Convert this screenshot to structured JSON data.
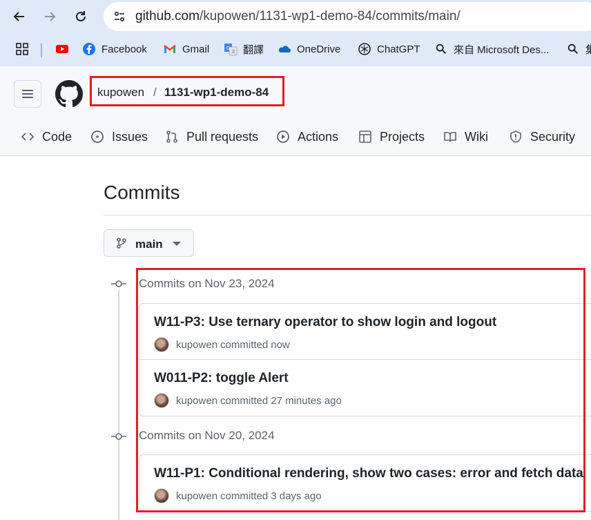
{
  "browser": {
    "url_host": "github.com",
    "url_path": "/kupowen/1131-wp1-demo-84/commits/main/",
    "bookmarks": [
      {
        "label": "",
        "icon": "apps-grid-icon"
      },
      {
        "label": "",
        "icon": "youtube-icon"
      },
      {
        "label": "Facebook",
        "icon": "facebook-icon"
      },
      {
        "label": "Gmail",
        "icon": "gmail-icon"
      },
      {
        "label": "翻譯",
        "icon": "translate-icon"
      },
      {
        "label": "OneDrive",
        "icon": "onedrive-icon"
      },
      {
        "label": "ChatGPT",
        "icon": "chatgpt-icon"
      },
      {
        "label": "來自 Microsoft Des...",
        "icon": "search-icon"
      },
      {
        "label": "集",
        "icon": "search-icon"
      }
    ]
  },
  "repo": {
    "owner": "kupowen",
    "separator": "/",
    "name": "1131-wp1-demo-84"
  },
  "tabs": [
    {
      "label": "Code",
      "icon": "code-icon"
    },
    {
      "label": "Issues",
      "icon": "issues-icon"
    },
    {
      "label": "Pull requests",
      "icon": "pull-request-icon"
    },
    {
      "label": "Actions",
      "icon": "actions-play-icon"
    },
    {
      "label": "Projects",
      "icon": "projects-table-icon"
    },
    {
      "label": "Wiki",
      "icon": "wiki-book-icon"
    },
    {
      "label": "Security",
      "icon": "shield-icon"
    }
  ],
  "page": {
    "title": "Commits",
    "branch": "main"
  },
  "commit_groups": [
    {
      "heading": "Commits on Nov 23, 2024",
      "commits": [
        {
          "title": "W11-P3: Use ternary operator to show login and logout",
          "author": "kupowen",
          "verb": "committed",
          "time": "now"
        },
        {
          "title": "W011-P2: toggle Alert",
          "author": "kupowen",
          "verb": "committed",
          "time": "27 minutes ago"
        }
      ]
    },
    {
      "heading": "Commits on Nov 20, 2024",
      "commits": [
        {
          "title": "W11-P1: Conditional rendering, show two cases: error and fetch data",
          "author": "kupowen",
          "verb": "committed",
          "time": "3 days ago"
        }
      ]
    }
  ],
  "colors": {
    "highlight": "#e01e2a",
    "chrome_bg": "#dfe9f7",
    "header_bg": "#f6f8fa",
    "border": "#d1d9e0",
    "muted_text": "#59636e"
  }
}
